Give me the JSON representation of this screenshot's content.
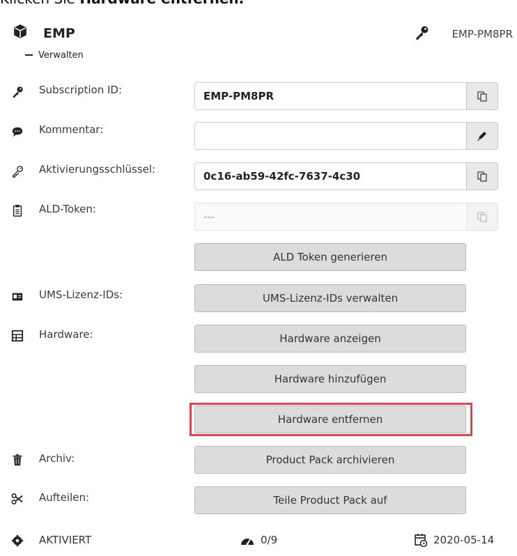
{
  "header": {
    "partial_title_prefix": "Klicken Sie ",
    "partial_title_bold": "Hardware entfernen."
  },
  "card": {
    "title": "EMP",
    "product_code": "EMP-PM8PR",
    "manage_label": "Verwalten"
  },
  "fields": {
    "subscription_id": {
      "label": "Subscription ID:",
      "value": "EMP-PM8PR"
    },
    "kommentar": {
      "label": "Kommentar:",
      "value": ""
    },
    "aktivierungsschluessel": {
      "label": "Aktivierungsschlüssel:",
      "value": "0c16-ab59-42fc-7637-4c30"
    },
    "ald_token": {
      "label": "ALD-Token:",
      "value": "---"
    }
  },
  "rows": {
    "ums_label": "UMS-Lizenz-IDs:",
    "hardware_label": "Hardware:",
    "archiv_label": "Archiv:",
    "aufteilen_label": "Aufteilen:"
  },
  "buttons": {
    "ald_generate": "ALD Token generieren",
    "ums_manage": "UMS-Lizenz-IDs verwalten",
    "hw_show": "Hardware anzeigen",
    "hw_add": "Hardware hinzufügen",
    "hw_remove": "Hardware entfernen",
    "archive": "Product Pack archivieren",
    "split": "Teile Product Pack auf"
  },
  "footer": {
    "status": "AKTIVIERT",
    "count": "0/9",
    "date": "2020-05-14"
  },
  "colors": {
    "highlight": "#e0474c",
    "button_bg": "#dcdcdc",
    "addon_bg": "#e9e9e9"
  }
}
